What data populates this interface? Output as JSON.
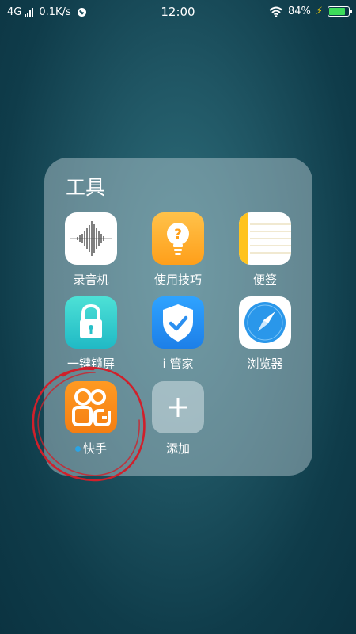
{
  "status_bar": {
    "network": "4G",
    "speed": "0.1K/s",
    "time": "12:00",
    "battery_percent": "84%",
    "battery_level": 0.84
  },
  "folder": {
    "title": "工具",
    "apps": [
      {
        "label": "录音机",
        "icon": "voice-recorder-icon"
      },
      {
        "label": "使用技巧",
        "icon": "tips-bulb-icon"
      },
      {
        "label": "便签",
        "icon": "notes-icon"
      },
      {
        "label": "一键锁屏",
        "icon": "lock-screen-icon"
      },
      {
        "label": "i 管家",
        "icon": "shield-check-icon"
      },
      {
        "label": "浏览器",
        "icon": "browser-compass-icon"
      },
      {
        "label": "快手",
        "icon": "kuaishou-icon"
      },
      {
        "label": "添加",
        "icon": "add-icon"
      }
    ]
  },
  "colors": {
    "annotation": "#d0202b",
    "kuaishou": "#f57e12",
    "new_dot": "#2aa4e6"
  }
}
